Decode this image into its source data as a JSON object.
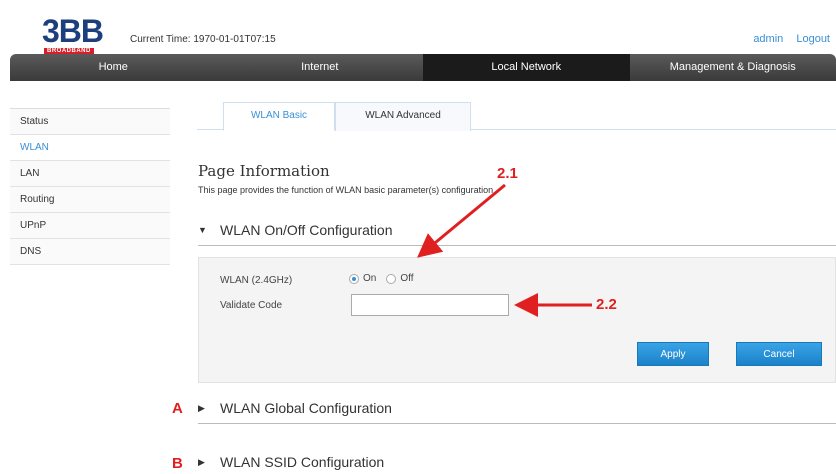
{
  "header": {
    "logo_text": "3BB",
    "logo_tag": "BROADBAND",
    "current_time": "Current Time: 1970-01-01T07:15",
    "user": "admin",
    "logout": "Logout"
  },
  "nav": {
    "items": [
      "Home",
      "Internet",
      "Local Network",
      "Management & Diagnosis"
    ],
    "active": "Local Network"
  },
  "sidebar": {
    "items": [
      "Status",
      "WLAN",
      "LAN",
      "Routing",
      "UPnP",
      "DNS"
    ],
    "active": "WLAN"
  },
  "tabs": {
    "items": [
      "WLAN Basic",
      "WLAN Advanced"
    ],
    "active": "WLAN Basic"
  },
  "page": {
    "title": "Page Information",
    "description": "This page provides the function of WLAN basic parameter(s) configuration."
  },
  "sections": {
    "onoff": "WLAN On/Off Configuration",
    "global": "WLAN Global Configuration",
    "ssid": "WLAN SSID Configuration"
  },
  "form": {
    "wlan_label": "WLAN (2.4GHz)",
    "on_label": "On",
    "off_label": "Off",
    "selected": "On",
    "validate_label": "Validate Code",
    "validate_value": "",
    "apply": "Apply",
    "cancel": "Cancel"
  },
  "annotations": {
    "a21": "2.1",
    "a22": "2.2",
    "A": "A",
    "B": "B"
  },
  "colors": {
    "accent": "#3a8fd6",
    "nav_bg": "#3a3a3a",
    "nav_active": "#1b1b1b",
    "annotation": "#e02020",
    "logo_blue": "#1d3f7d",
    "logo_red": "#d51f2a"
  }
}
